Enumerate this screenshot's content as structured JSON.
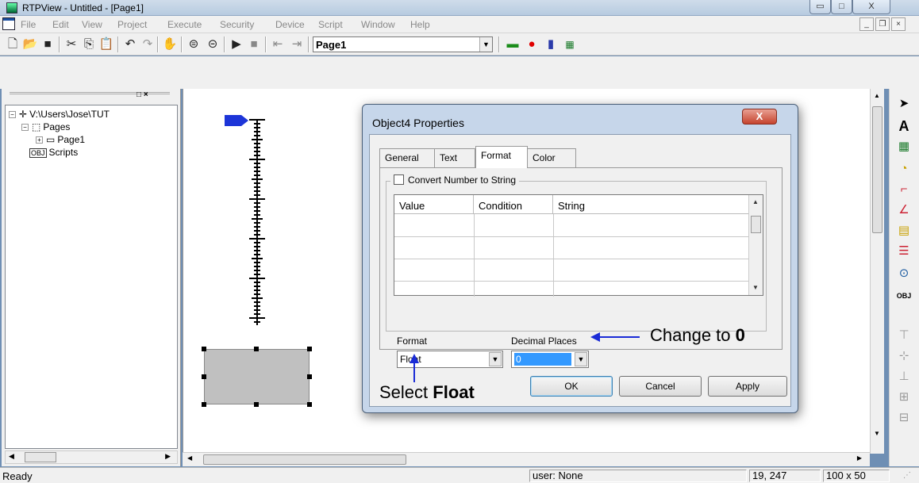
{
  "window": {
    "title": "RTPView  -  Untitled - [Page1]",
    "min_glyph": "▭",
    "max_glyph": "□",
    "close_glyph": "X"
  },
  "menu": {
    "items": [
      "File",
      "Edit",
      "View",
      "Project",
      "Execute",
      "Security",
      "Device",
      "Script",
      "Window",
      "Help"
    ]
  },
  "mdi": {
    "min": "_",
    "restore": "❐",
    "close": "×"
  },
  "toolbar": {
    "page_combo_value": "Page1",
    "icons": [
      "new-file-icon",
      "open-folder-icon",
      "save-icon",
      "cut-icon",
      "copy-icon",
      "paste-icon",
      "undo-icon",
      "redo-icon",
      "hand-tool-icon",
      "lock-icon",
      "unlock-icon",
      "run-icon",
      "stop-icon",
      "prev-page-icon",
      "next-page-icon",
      "green-block-icon",
      "record-icon",
      "bar-chart-icon",
      "rtp-icon"
    ]
  },
  "tree": {
    "root": "V:\\Users\\Jose\\TUT",
    "pages": "Pages",
    "page1": "Page1",
    "scripts": "Scripts"
  },
  "dialog": {
    "title": "Object4 Properties",
    "close": "X",
    "tabs": [
      "General",
      "Text",
      "Format",
      "Color"
    ],
    "active_tab": "Format",
    "convert_label": "Convert Number to String",
    "grid_headers": [
      "Value",
      "Condition",
      "String"
    ],
    "format_label": "Format",
    "format_value": "Float",
    "decimal_label": "Decimal Places",
    "decimal_value": "0",
    "ok": "OK",
    "cancel": "Cancel",
    "apply": "Apply"
  },
  "annotations": {
    "change_prefix": "Change to ",
    "change_value": "0",
    "select_prefix": "Select ",
    "select_value": "Float"
  },
  "status": {
    "ready": "Ready",
    "user": "user: None",
    "position": "19, 247",
    "size": "100 x 50"
  },
  "colors": {
    "dialog_frame": "#c6d6ea",
    "annotation_arrow": "#1a2bd6",
    "pointer": "#1d35d8",
    "selection_highlight": "#3399ff"
  }
}
